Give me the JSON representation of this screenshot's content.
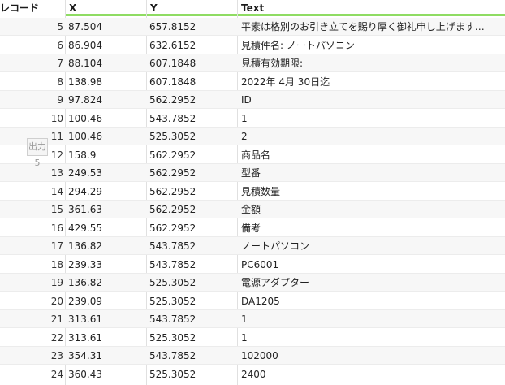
{
  "columns": {
    "record": "レコード",
    "x": "X",
    "y": "Y",
    "text": "Text"
  },
  "output_tag": "出力5",
  "rows": [
    {
      "n": "5",
      "x": "87.504",
      "y": "657.8152",
      "text": "平素は格別のお引き立てを賜り厚く御礼申し上げます…"
    },
    {
      "n": "6",
      "x": "86.904",
      "y": "632.6152",
      "text": "見積件名: ノートパソコン"
    },
    {
      "n": "7",
      "x": "88.104",
      "y": "607.1848",
      "text": "見積有効期限:"
    },
    {
      "n": "8",
      "x": "138.98",
      "y": "607.1848",
      "text": "2022年 4月 30日迄"
    },
    {
      "n": "9",
      "x": "97.824",
      "y": "562.2952",
      "text": "ID"
    },
    {
      "n": "10",
      "x": "100.46",
      "y": "543.7852",
      "text": "1"
    },
    {
      "n": "11",
      "x": "100.46",
      "y": "525.3052",
      "text": "2"
    },
    {
      "n": "12",
      "x": "158.9",
      "y": "562.2952",
      "text": "商品名"
    },
    {
      "n": "13",
      "x": "249.53",
      "y": "562.2952",
      "text": "型番"
    },
    {
      "n": "14",
      "x": "294.29",
      "y": "562.2952",
      "text": "見積数量"
    },
    {
      "n": "15",
      "x": "361.63",
      "y": "562.2952",
      "text": "金額"
    },
    {
      "n": "16",
      "x": "429.55",
      "y": "562.2952",
      "text": "備考"
    },
    {
      "n": "17",
      "x": "136.82",
      "y": "543.7852",
      "text": "ノートパソコン"
    },
    {
      "n": "18",
      "x": "239.33",
      "y": "543.7852",
      "text": "PC6001"
    },
    {
      "n": "19",
      "x": "136.82",
      "y": "525.3052",
      "text": "電源アダプター"
    },
    {
      "n": "20",
      "x": "239.09",
      "y": "525.3052",
      "text": "DA1205"
    },
    {
      "n": "21",
      "x": "313.61",
      "y": "543.7852",
      "text": "1"
    },
    {
      "n": "22",
      "x": "313.61",
      "y": "525.3052",
      "text": "1"
    },
    {
      "n": "23",
      "x": "354.31",
      "y": "543.7852",
      "text": "102000"
    },
    {
      "n": "24",
      "x": "360.43",
      "y": "525.3052",
      "text": "2400"
    }
  ]
}
